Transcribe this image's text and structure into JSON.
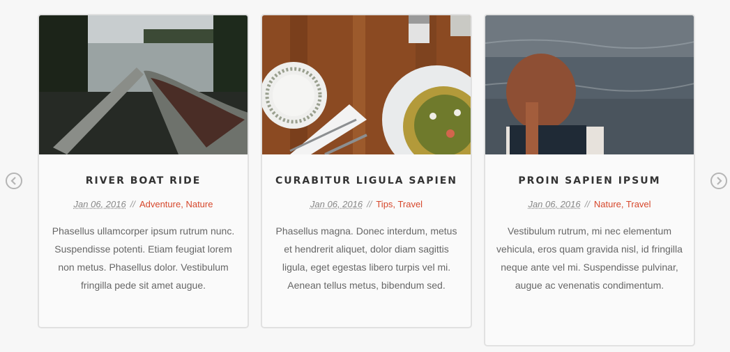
{
  "carousel": {
    "prev_icon": "chevron-left-icon",
    "next_icon": "chevron-right-icon"
  },
  "colors": {
    "accent": "#d6472b",
    "title": "#333333",
    "text": "#666666",
    "border": "#e1e1e1"
  },
  "cards": [
    {
      "title": "RIVER BOAT RIDE",
      "date": "Jan 06, 2016",
      "separator": "//",
      "categories": [
        "Adventure",
        "Nature"
      ],
      "category_delim": ",",
      "excerpt": "Phasellus ullamcorper ipsum rutrum nunc. Suspendisse potenti. Etiam feugiat lorem non metus. Phasellus dolor. Vestibulum fringilla pede sit amet augue."
    },
    {
      "title": "CURABITUR LIGULA SAPIEN",
      "date": "Jan 06, 2016",
      "separator": "//",
      "categories": [
        "Tips",
        "Travel"
      ],
      "category_delim": ",",
      "excerpt": "Phasellus magna. Donec interdum, metus et hendrerit aliquet, dolor diam sagittis ligula, eget egestas libero turpis vel mi. Aenean tellus metus, bibendum sed."
    },
    {
      "title": "PROIN SAPIEN IPSUM",
      "date": "Jan 06, 2016",
      "separator": "//",
      "categories": [
        "Nature",
        "Travel"
      ],
      "category_delim": ",",
      "excerpt": "Vestibulum rutrum, mi nec elementum vehicula, eros quam gravida nisl, id fringilla neque ante vel mi. Suspendisse pulvinar, augue ac venenatis condimentum."
    }
  ]
}
